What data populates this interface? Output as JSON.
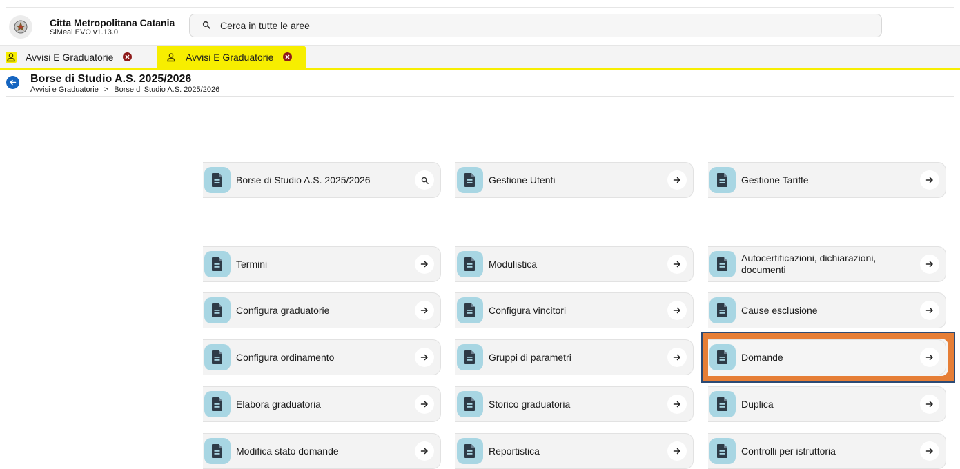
{
  "header": {
    "org_name": "Citta Metropolitana Catania",
    "app_version": "SiMeal EVO v1.13.0",
    "search_placeholder": "Cerca in tutte le aree"
  },
  "tabs": [
    {
      "label": "Avvisi E Graduatorie",
      "active": false
    },
    {
      "label": "Avvisi E Graduatorie",
      "active": true
    }
  ],
  "page": {
    "title": "Borse di Studio A.S. 2025/2026",
    "breadcrumb": [
      "Avvisi e Graduatorie",
      "Borse di Studio A.S. 2025/2026"
    ],
    "breadcrumb_separator": ">"
  },
  "cards_top": [
    {
      "label": "Borse di Studio A.S. 2025/2026",
      "action_icon": "search-icon"
    },
    {
      "label": "Gestione Utenti",
      "action_icon": "arrow-right-icon"
    },
    {
      "label": "Gestione Tariffe",
      "action_icon": "arrow-right-icon"
    }
  ],
  "cards_grid": [
    {
      "label": "Termini"
    },
    {
      "label": "Modulistica"
    },
    {
      "label": "Autocertificazioni, dichiarazioni, documenti"
    },
    {
      "label": "Configura graduatorie"
    },
    {
      "label": "Configura vincitori"
    },
    {
      "label": "Cause esclusione"
    },
    {
      "label": "Configura ordinamento"
    },
    {
      "label": "Gruppi di parametri"
    },
    {
      "label": "Domande",
      "highlighted": true
    },
    {
      "label": "Elabora graduatoria"
    },
    {
      "label": "Storico graduatoria"
    },
    {
      "label": "Duplica"
    },
    {
      "label": "Modifica stato domande"
    },
    {
      "label": "Reportistica"
    },
    {
      "label": "Controlli per istruttoria"
    }
  ],
  "colors": {
    "tab_active": "#f7ee00",
    "back_button": "#1565c0",
    "card_badge": "#a8d6e3",
    "highlight_fill": "#e67e36",
    "highlight_border": "#2c4a74",
    "tab_close": "#8e1b1b"
  }
}
